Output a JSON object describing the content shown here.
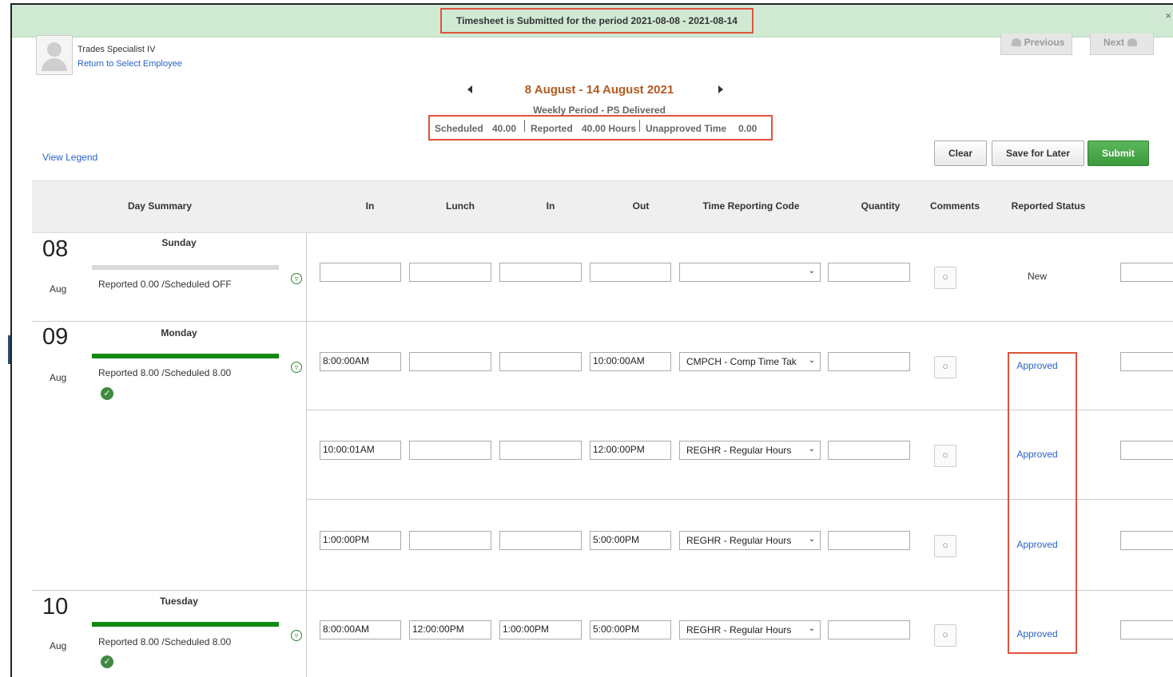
{
  "banner": {
    "message": "Timesheet is Submitted for the period 2021-08-08 - 2021-08-14",
    "close": "×"
  },
  "employee": {
    "title": "Trades Specialist IV",
    "return_link": "Return to Select Employee"
  },
  "nav": {
    "previous": "Previous",
    "next": "Next"
  },
  "period": {
    "title": "8 August - 14 August 2021",
    "subtitle": "Weekly Period - PS Delivered"
  },
  "summary": {
    "scheduled_label": "Scheduled",
    "scheduled_value": "40.00",
    "reported_label": "Reported",
    "reported_value": "40.00 Hours",
    "unapproved_label": "Unapproved Time",
    "unapproved_value": "0.00"
  },
  "legend": "View Legend",
  "actions": {
    "clear": "Clear",
    "save": "Save for Later",
    "submit": "Submit"
  },
  "columns": {
    "day_summary": "Day Summary",
    "in1": "In",
    "lunch": "Lunch",
    "in2": "In",
    "out": "Out",
    "trc": "Time Reporting Code",
    "quantity": "Quantity",
    "comments": "Comments",
    "status": "Reported Status"
  },
  "days": [
    {
      "num": "08",
      "month": "Aug",
      "name": "Sunday",
      "reported": "Reported 0.00 /Scheduled OFF",
      "bar_color": "#d9d9d9",
      "check": false
    },
    {
      "num": "09",
      "month": "Aug",
      "name": "Monday",
      "reported": "Reported 8.00 /Scheduled 8.00",
      "bar_color": "#138a13",
      "check": true
    },
    {
      "num": "10",
      "month": "Aug",
      "name": "Tuesday",
      "reported": "Reported 8.00 /Scheduled 8.00",
      "bar_color": "#138a13",
      "check": true
    }
  ],
  "rows": [
    {
      "in1": "",
      "lunch": "",
      "in2": "",
      "out": "",
      "trc": "",
      "quantity": "",
      "status": "New"
    },
    {
      "in1": "8:00:00AM",
      "lunch": "",
      "in2": "",
      "out": "10:00:00AM",
      "trc": "CMPCH - Comp Time Tak",
      "quantity": "",
      "status": "Approved"
    },
    {
      "in1": "10:00:01AM",
      "lunch": "",
      "in2": "",
      "out": "12:00:00PM",
      "trc": "REGHR - Regular Hours",
      "quantity": "",
      "status": "Approved"
    },
    {
      "in1": "1:00:00PM",
      "lunch": "",
      "in2": "",
      "out": "5:00:00PM",
      "trc": "REGHR - Regular Hours",
      "quantity": "",
      "status": "Approved"
    },
    {
      "in1": "8:00:00AM",
      "lunch": "12:00:00PM",
      "in2": "1:00:00PM",
      "out": "5:00:00PM",
      "trc": "REGHR - Regular Hours",
      "quantity": "",
      "status": "Approved"
    }
  ],
  "icons": {
    "check": "✓",
    "expand": "▿",
    "comment": "○",
    "caret": "⌄",
    "pause": "II"
  }
}
